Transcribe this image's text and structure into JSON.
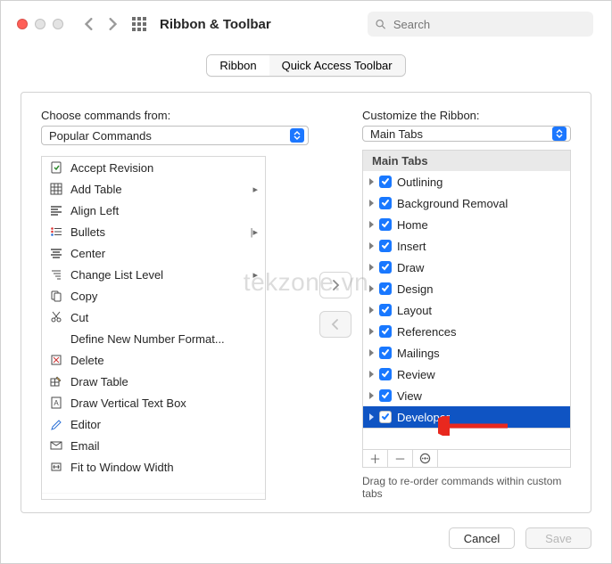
{
  "header": {
    "title": "Ribbon & Toolbar"
  },
  "search": {
    "placeholder": "Search"
  },
  "tabs": {
    "ribbon": "Ribbon",
    "qat": "Quick Access Toolbar"
  },
  "left": {
    "label": "Choose commands from:",
    "select": "Popular Commands",
    "commands": [
      "Accept Revision",
      "Add Table",
      "Align Left",
      "Bullets",
      "Center",
      "Change List Level",
      "Copy",
      "Cut",
      "Define New Number Format...",
      "Delete",
      "Draw Table",
      "Draw Vertical Text Box",
      "Editor",
      "Email",
      "Fit to Window Width"
    ]
  },
  "right": {
    "label": "Customize the Ribbon:",
    "select": "Main Tabs",
    "heading": "Main Tabs",
    "tabs": [
      "Outlining",
      "Background Removal",
      "Home",
      "Insert",
      "Draw",
      "Design",
      "Layout",
      "References",
      "Mailings",
      "Review",
      "View",
      "Developer"
    ],
    "hint": "Drag to re-order commands within custom tabs"
  },
  "footer": {
    "cancel": "Cancel",
    "save": "Save"
  },
  "watermark": "tekzone.vn"
}
